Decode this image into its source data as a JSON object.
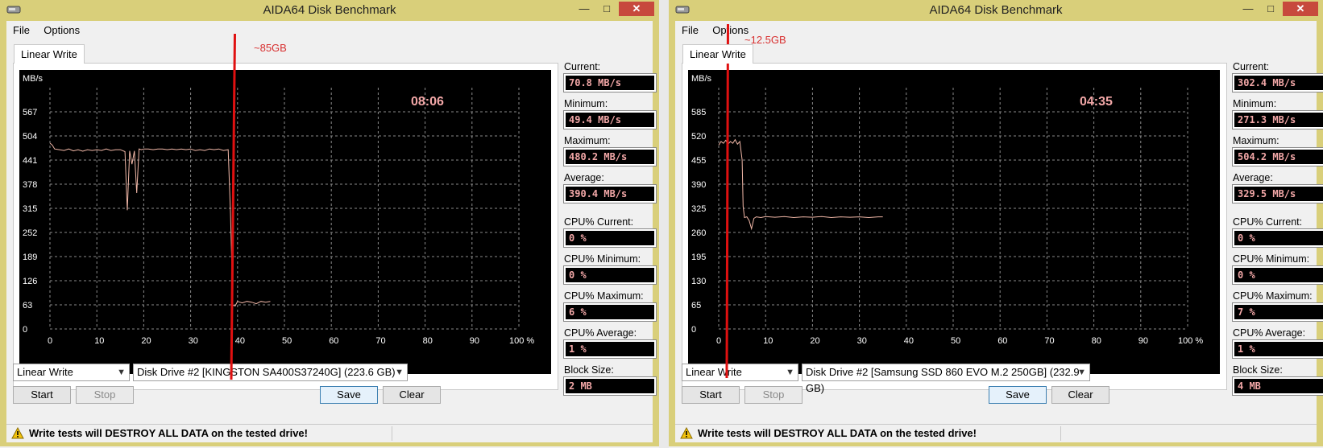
{
  "windows": [
    {
      "title": "AIDA64 Disk Benchmark",
      "menu": [
        "File",
        "Options"
      ],
      "tab": "Linear Write",
      "annotation": "~85GB",
      "chart": {
        "timer": "08:06",
        "unit": "MB/s",
        "ylabels": [
          "567",
          "504",
          "441",
          "378",
          "315",
          "252",
          "189",
          "126",
          "63",
          "0"
        ],
        "xlabels": [
          "0",
          "10",
          "20",
          "30",
          "40",
          "50",
          "60",
          "70",
          "80",
          "90",
          "100 %"
        ]
      },
      "stats": [
        {
          "label": "Current:",
          "value": "70.8 MB/s"
        },
        {
          "label": "Minimum:",
          "value": "49.4 MB/s"
        },
        {
          "label": "Maximum:",
          "value": "480.2 MB/s"
        },
        {
          "label": "Average:",
          "value": "390.4 MB/s"
        },
        {
          "label": "CPU% Current:",
          "value": "0 %"
        },
        {
          "label": "CPU% Minimum:",
          "value": "0 %"
        },
        {
          "label": "CPU% Maximum:",
          "value": "6 %"
        },
        {
          "label": "CPU% Average:",
          "value": "1 %"
        },
        {
          "label": "Block Size:",
          "value": "2 MB"
        }
      ],
      "test_select": "Linear Write",
      "drive_select": "Disk Drive #2  [KINGSTON SA400S37240G]  (223.6 GB)",
      "buttons": {
        "start": "Start",
        "stop": "Stop",
        "save": "Save",
        "clear": "Clear"
      },
      "status": "Write tests will DESTROY ALL DATA on the tested drive!"
    },
    {
      "title": "AIDA64 Disk Benchmark",
      "menu": [
        "File",
        "Options"
      ],
      "tab": "Linear Write",
      "annotation": "~12.5GB",
      "chart": {
        "timer": "04:35",
        "unit": "MB/s",
        "ylabels": [
          "585",
          "520",
          "455",
          "390",
          "325",
          "260",
          "195",
          "130",
          "65",
          "0"
        ],
        "xlabels": [
          "0",
          "10",
          "20",
          "30",
          "40",
          "50",
          "60",
          "70",
          "80",
          "90",
          "100 %"
        ]
      },
      "stats": [
        {
          "label": "Current:",
          "value": "302.4 MB/s"
        },
        {
          "label": "Minimum:",
          "value": "271.3 MB/s"
        },
        {
          "label": "Maximum:",
          "value": "504.2 MB/s"
        },
        {
          "label": "Average:",
          "value": "329.5 MB/s"
        },
        {
          "label": "CPU% Current:",
          "value": "0 %"
        },
        {
          "label": "CPU% Minimum:",
          "value": "0 %"
        },
        {
          "label": "CPU% Maximum:",
          "value": "7 %"
        },
        {
          "label": "CPU% Average:",
          "value": "1 %"
        },
        {
          "label": "Block Size:",
          "value": "4 MB"
        }
      ],
      "test_select": "Linear Write",
      "drive_select": "Disk Drive #2  [Samsung SSD 860 EVO M.2 250GB]  (232.9 GB)",
      "buttons": {
        "start": "Start",
        "stop": "Stop",
        "save": "Save",
        "clear": "Clear"
      },
      "status": "Write tests will DESTROY ALL DATA on the tested drive!"
    }
  ],
  "colors": {
    "plot_bg": "#000000",
    "grid": "#8a8a8a",
    "trace": "#f2b8a8",
    "value_text": "#f2a7a7",
    "marker": "#e01010",
    "annotation": "#d83030"
  },
  "chart_data": [
    {
      "type": "line",
      "title": "",
      "xlabel": "",
      "ylabel": "MB/s",
      "xlim": [
        0,
        100
      ],
      "ylim": [
        0,
        630
      ],
      "grid": true,
      "series": [
        {
          "x": [
            0,
            0.5,
            1,
            2,
            3,
            4,
            5,
            6,
            7,
            8,
            9,
            10,
            11,
            12,
            13,
            14,
            15,
            16,
            16.5,
            17,
            17.5,
            18,
            18.5,
            19,
            19.5,
            20,
            21,
            22,
            23,
            24,
            25,
            26,
            27,
            28,
            29,
            30,
            31,
            32,
            33,
            34,
            35,
            36,
            37,
            38,
            38.5,
            39,
            39.5,
            40,
            40.5,
            41,
            42,
            43,
            44,
            45,
            46,
            47
          ],
          "y": [
            485,
            480,
            470,
            468,
            466,
            470,
            465,
            468,
            464,
            468,
            466,
            468,
            466,
            470,
            466,
            468,
            468,
            463,
            310,
            465,
            430,
            465,
            355,
            470,
            468,
            470,
            470,
            468,
            470,
            470,
            468,
            470,
            468,
            470,
            468,
            470,
            466,
            468,
            466,
            470,
            468,
            470,
            466,
            468,
            300,
            62,
            60,
            72,
            70,
            68,
            72,
            70,
            66,
            72,
            70,
            72
          ]
        }
      ]
    },
    {
      "type": "line",
      "title": "",
      "xlabel": "",
      "ylabel": "MB/s",
      "xlim": [
        0,
        100
      ],
      "ylim": [
        0,
        650
      ],
      "grid": true,
      "series": [
        {
          "x": [
            0,
            0.5,
            1,
            1.5,
            2,
            2.5,
            3,
            3.5,
            4,
            4.5,
            5,
            5.2,
            5.5,
            6,
            6.5,
            7,
            7.5,
            8,
            9,
            10,
            12,
            14,
            16,
            18,
            20,
            22,
            24,
            26,
            28,
            30,
            32,
            34,
            35
          ],
          "y": [
            495,
            505,
            500,
            508,
            498,
            505,
            500,
            510,
            498,
            505,
            455,
            330,
            300,
            302,
            292,
            270,
            298,
            302,
            300,
            303,
            301,
            303,
            300,
            302,
            301,
            303,
            300,
            302,
            301,
            302,
            300,
            302,
            302
          ]
        }
      ]
    }
  ]
}
